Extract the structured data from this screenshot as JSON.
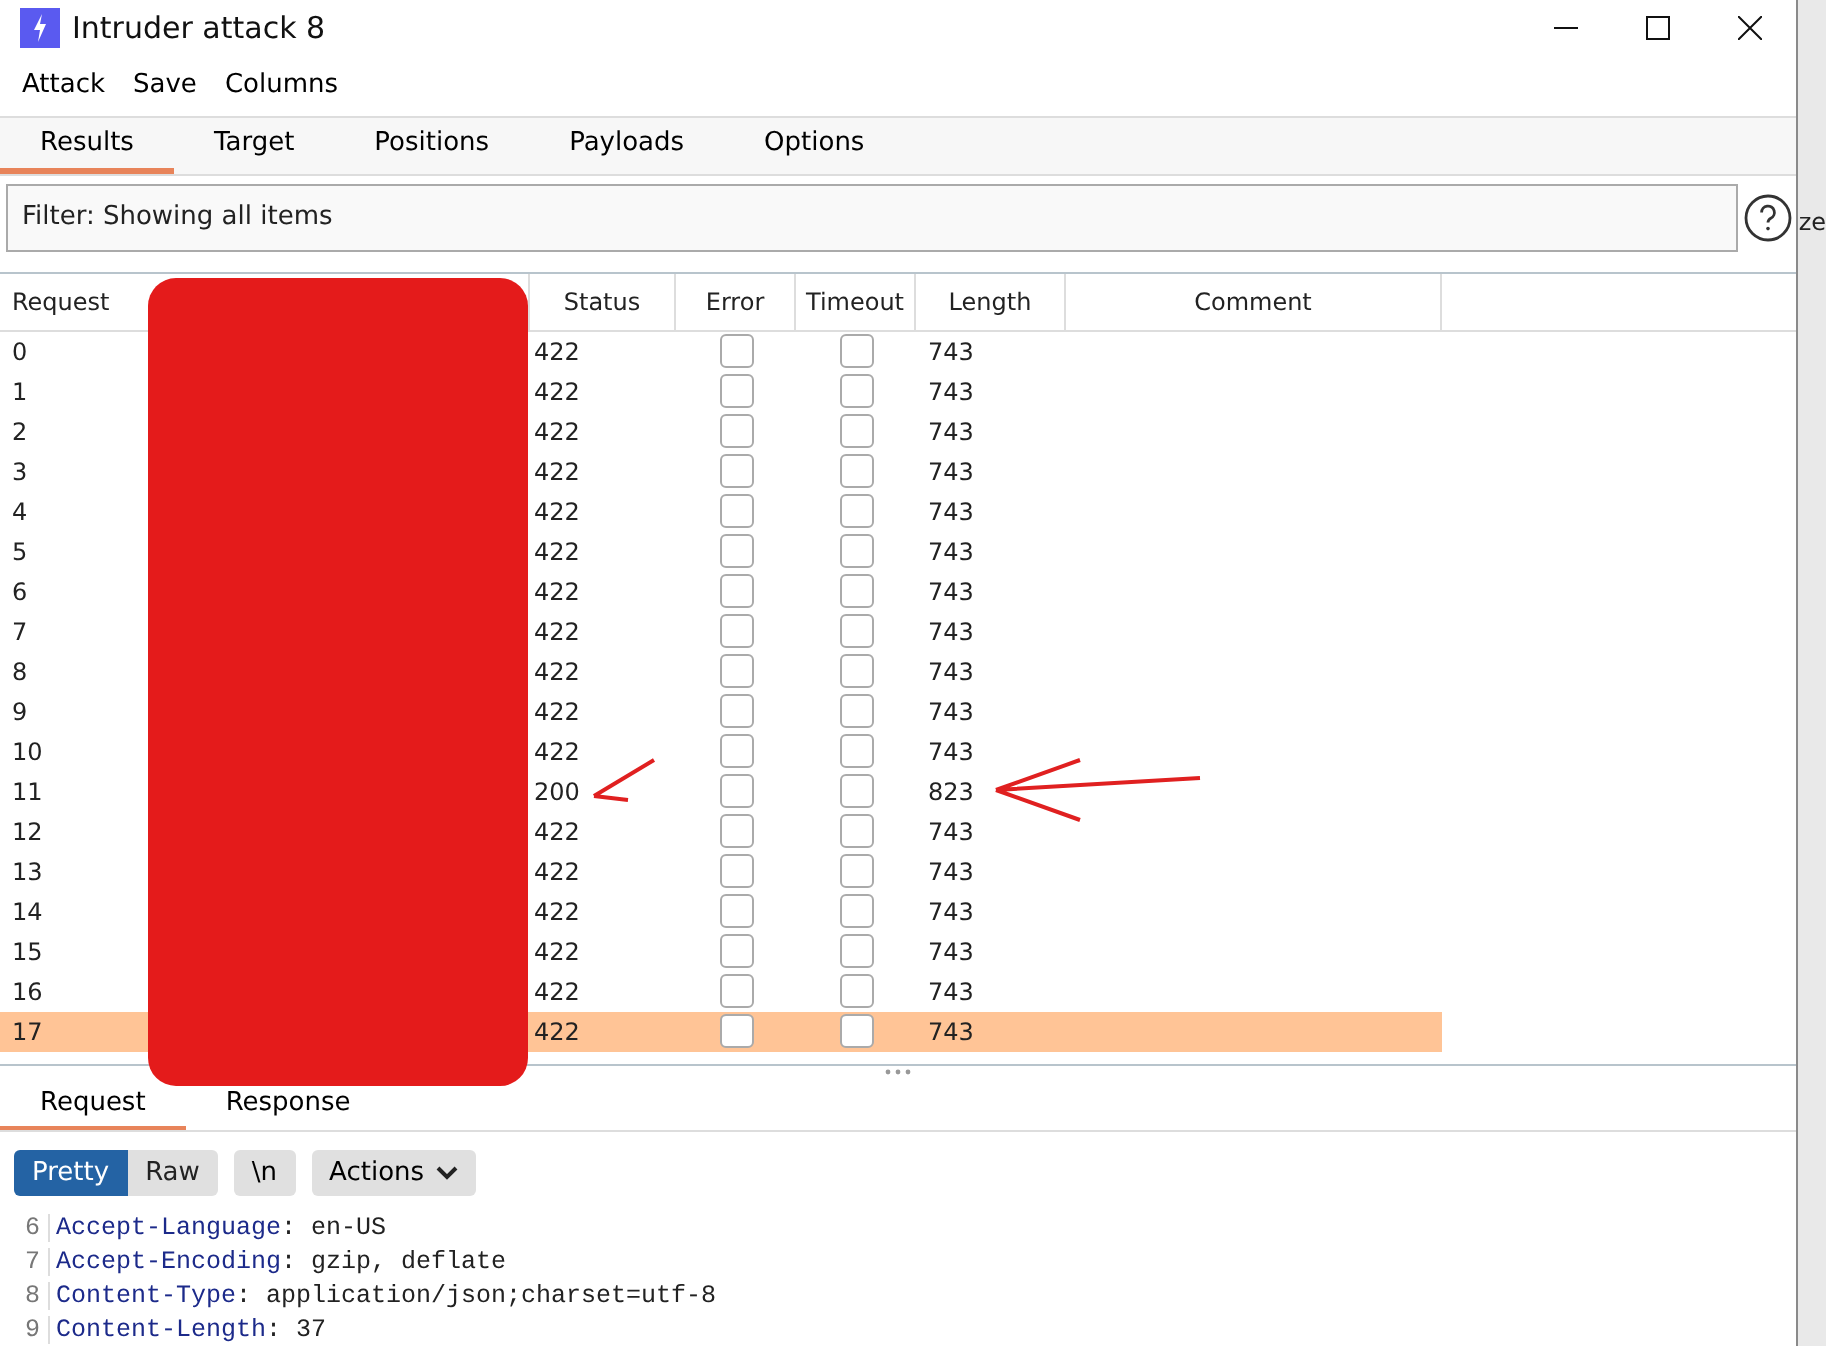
{
  "window": {
    "title": "Intruder attack 8"
  },
  "menu": [
    "Attack",
    "Save",
    "Columns"
  ],
  "tabs": [
    {
      "label": "Results",
      "selected": true
    },
    {
      "label": "Target",
      "selected": false
    },
    {
      "label": "Positions",
      "selected": false
    },
    {
      "label": "Payloads",
      "selected": false
    },
    {
      "label": "Options",
      "selected": false
    }
  ],
  "filter": {
    "text": "Filter: Showing all items"
  },
  "background_text": "ze",
  "table": {
    "columns": [
      "Request",
      "",
      "Status",
      "Error",
      "Timeout",
      "Length",
      "Comment"
    ],
    "rows": [
      {
        "request": "0",
        "status": "422",
        "error": false,
        "timeout": false,
        "length": "743",
        "selected": false
      },
      {
        "request": "1",
        "status": "422",
        "error": false,
        "timeout": false,
        "length": "743",
        "selected": false
      },
      {
        "request": "2",
        "status": "422",
        "error": false,
        "timeout": false,
        "length": "743",
        "selected": false
      },
      {
        "request": "3",
        "status": "422",
        "error": false,
        "timeout": false,
        "length": "743",
        "selected": false
      },
      {
        "request": "4",
        "status": "422",
        "error": false,
        "timeout": false,
        "length": "743",
        "selected": false
      },
      {
        "request": "5",
        "status": "422",
        "error": false,
        "timeout": false,
        "length": "743",
        "selected": false
      },
      {
        "request": "6",
        "status": "422",
        "error": false,
        "timeout": false,
        "length": "743",
        "selected": false
      },
      {
        "request": "7",
        "status": "422",
        "error": false,
        "timeout": false,
        "length": "743",
        "selected": false
      },
      {
        "request": "8",
        "status": "422",
        "error": false,
        "timeout": false,
        "length": "743",
        "selected": false
      },
      {
        "request": "9",
        "status": "422",
        "error": false,
        "timeout": false,
        "length": "743",
        "selected": false
      },
      {
        "request": "10",
        "status": "422",
        "error": false,
        "timeout": false,
        "length": "743",
        "selected": false
      },
      {
        "request": "11",
        "status": "200",
        "error": false,
        "timeout": false,
        "length": "823",
        "selected": false
      },
      {
        "request": "12",
        "status": "422",
        "error": false,
        "timeout": false,
        "length": "743",
        "selected": false
      },
      {
        "request": "13",
        "status": "422",
        "error": false,
        "timeout": false,
        "length": "743",
        "selected": false
      },
      {
        "request": "14",
        "status": "422",
        "error": false,
        "timeout": false,
        "length": "743",
        "selected": false
      },
      {
        "request": "15",
        "status": "422",
        "error": false,
        "timeout": false,
        "length": "743",
        "selected": false
      },
      {
        "request": "16",
        "status": "422",
        "error": false,
        "timeout": false,
        "length": "743",
        "selected": false
      },
      {
        "request": "17",
        "status": "422",
        "error": false,
        "timeout": false,
        "length": "743",
        "selected": true
      }
    ]
  },
  "detail_tabs": [
    {
      "label": "Request",
      "selected": true
    },
    {
      "label": "Response",
      "selected": false
    }
  ],
  "view_buttons": [
    {
      "label": "Pretty",
      "selected": true
    },
    {
      "label": "Raw",
      "selected": false
    }
  ],
  "newline_button": "\\n",
  "actions_button": "Actions",
  "code": [
    {
      "line": "6",
      "key": "Accept-Language",
      "value": ": en-US"
    },
    {
      "line": "7",
      "key": "Accept-Encoding",
      "value": ": gzip, deflate"
    },
    {
      "line": "8",
      "key": "Content-Type",
      "value": ": application/json;charset=utf-8"
    },
    {
      "line": "9",
      "key": "Content-Length",
      "value": ": 37"
    }
  ]
}
